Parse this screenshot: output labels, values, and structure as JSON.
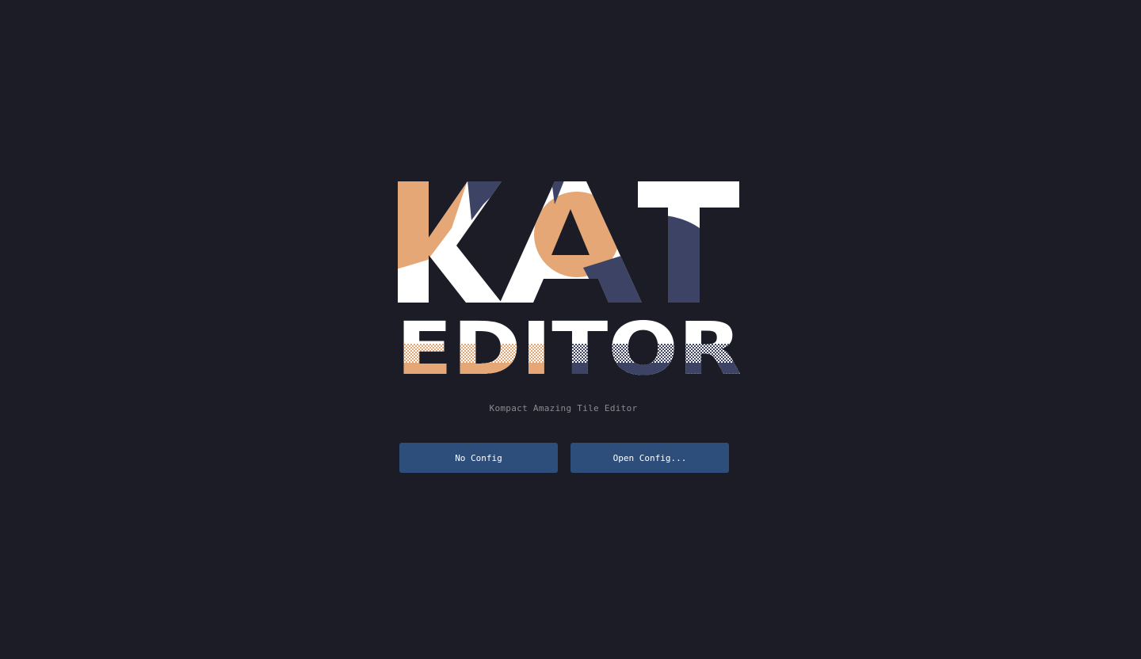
{
  "logo": {
    "line1": "KAT",
    "line2": "EDITOR",
    "colors": {
      "peach": "#e4a775",
      "white": "#ffffff",
      "navy": "#3c4365",
      "background": "#1b1c25"
    }
  },
  "subtitle": "Kompact Amazing Tile Editor",
  "buttons": {
    "no_config": "No Config",
    "open_config": "Open Config..."
  },
  "colors": {
    "background": "#1b1c25",
    "button": "#2d4d7a",
    "button_text": "#ffffff",
    "subtitle_text": "#8a8b92"
  }
}
